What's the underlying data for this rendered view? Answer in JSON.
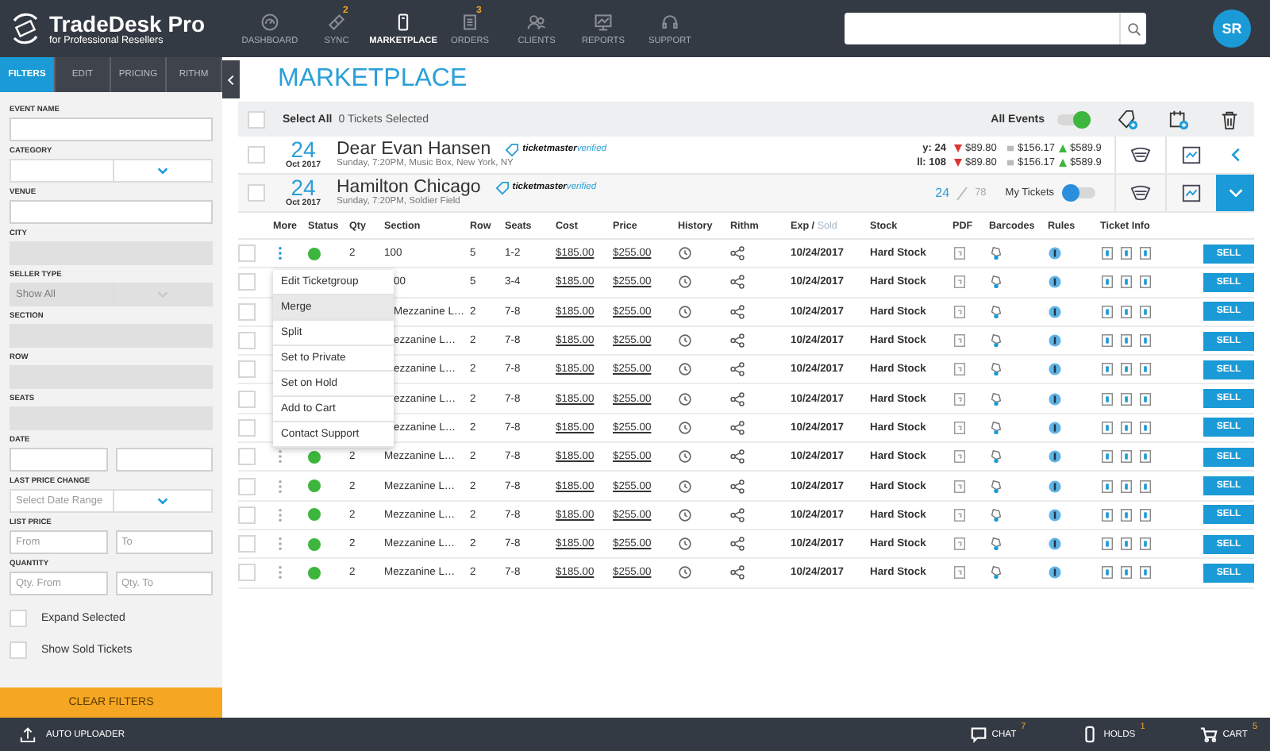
{
  "app": {
    "brand": "TradeDesk Pro",
    "tagline": "for Professional Resellers"
  },
  "nav": [
    {
      "label": "DASHBOARD",
      "kind": "gauge",
      "selected": false
    },
    {
      "label": "SYNC",
      "kind": "ticket",
      "badge": "2",
      "selected": false
    },
    {
      "label": "MARKETPLACE",
      "kind": "phone",
      "selected": true
    },
    {
      "label": "ORDERS",
      "kind": "orders",
      "badge": "3",
      "selected": false
    },
    {
      "label": "CLIENTS",
      "kind": "clients",
      "selected": false
    },
    {
      "label": "REPORTS",
      "kind": "reports",
      "selected": false
    },
    {
      "label": "SUPPORT",
      "kind": "support",
      "selected": false
    }
  ],
  "user": {
    "initials": "SR"
  },
  "sidebar": {
    "tabs": [
      {
        "label": "FILTERS",
        "selected": true
      },
      {
        "label": "EDIT",
        "selected": false
      },
      {
        "label": "PRICING",
        "selected": false
      },
      {
        "label": "RITHM",
        "selected": false
      }
    ],
    "fields": [
      {
        "label": "EVENT NAME",
        "kind": "text",
        "disabled": false
      },
      {
        "label": "CATEGORY",
        "kind": "select",
        "disabled": false
      },
      {
        "label": "VENUE",
        "kind": "text",
        "disabled": false
      },
      {
        "label": "CITY",
        "kind": "text",
        "disabled": true
      },
      {
        "label": "SELLER TYPE",
        "kind": "select",
        "disabled": true,
        "placeholder": "Show All"
      },
      {
        "label": "SECTION",
        "kind": "text",
        "disabled": true
      },
      {
        "label": "ROW",
        "kind": "text",
        "disabled": true
      },
      {
        "label": "SEATS",
        "kind": "text",
        "disabled": true
      },
      {
        "label": "DATE",
        "kind": "pair",
        "disabled": false
      },
      {
        "label": "LAST PRICE CHANGE",
        "kind": "select",
        "disabled": false,
        "placeholder": "Select Date Range"
      },
      {
        "label": "LIST PRICE",
        "kind": "pair",
        "disabled": false,
        "placeholders": [
          "From",
          "To"
        ]
      },
      {
        "label": "QUANTITY",
        "kind": "pair",
        "disabled": false,
        "placeholders": [
          "Qty. From",
          "Qty. To"
        ]
      }
    ],
    "checkboxes": [
      {
        "label": "Expand Selected",
        "checked": false
      },
      {
        "label": "Show Sold Tickets",
        "checked": false
      }
    ],
    "clear_button": "CLEAR FILTERS"
  },
  "page_title": "MARKETPLACE",
  "toolbar": {
    "select_all_checked": false,
    "select_all": "Select All",
    "selected_count": "0 Tickets Selected",
    "all_events_label": "All Events",
    "all_events_on": true
  },
  "events": [
    {
      "checked": false,
      "day": "24",
      "month": "Oct 2017",
      "name": "Dear Evan Hansen",
      "details": "Sunday, 7:20PM, Music Box, New York, NY",
      "verified_brand": "ticketmaster",
      "verified_word": "verified",
      "expanded": false,
      "stats": [
        {
          "label": "y: 24",
          "low": "$89.80",
          "avg": "$156.17",
          "high": "$589.9"
        },
        {
          "label": "ll: 108",
          "low": "$89.80",
          "avg": "$156.17",
          "high": "$589.9"
        }
      ]
    },
    {
      "checked": false,
      "day": "24",
      "month": "Oct 2017",
      "name": "Hamilton Chicago",
      "details": "Sunday, 7:20PM, Soldier Field",
      "verified_brand": "ticketmaster",
      "verified_word": "verified",
      "expanded": true,
      "my_count": "24",
      "total_count": "78",
      "my_tickets_label": "My Tickets",
      "my_tickets_on": false
    }
  ],
  "table": {
    "columns": [
      {
        "label": "More"
      },
      {
        "label": "Status"
      },
      {
        "label": "Qty"
      },
      {
        "label": "Section"
      },
      {
        "label": "Row"
      },
      {
        "label": "Seats"
      },
      {
        "label": "Cost"
      },
      {
        "label": "Price"
      },
      {
        "label": "History"
      },
      {
        "label": "Rithm"
      },
      {
        "label": "Exp /",
        "suffix": "Sold"
      },
      {
        "label": "Stock"
      },
      {
        "label": "PDF"
      },
      {
        "label": "Barcodes"
      },
      {
        "label": "Rules"
      },
      {
        "label": "Ticket Info"
      }
    ],
    "rows": [
      {
        "checked": false,
        "menu_open": true,
        "status_ok": true,
        "qty": "2",
        "section": "100",
        "row": "5",
        "seats": "1-2",
        "cost": "$185.00",
        "price": "$255.00",
        "exp": "10/24/2017",
        "stock": "Hard Stock",
        "action": "SELL"
      },
      {
        "checked": false,
        "section": "00",
        "row": "5",
        "seats": "3-4",
        "cost": "$185.00",
        "price": "$255.00",
        "exp": "10/24/2017",
        "stock": "Hard Stock",
        "action": "SELL"
      },
      {
        "checked": false,
        "section": "Mezzanine L…",
        "row": "2",
        "seats": "7-8",
        "cost": "$185.00",
        "price": "$255.00",
        "exp": "10/24/2017",
        "stock": "Hard Stock",
        "action": "SELL"
      },
      {
        "checked": false,
        "section": "ezzanine L…",
        "row": "2",
        "seats": "7-8",
        "cost": "$185.00",
        "price": "$255.00",
        "exp": "10/24/2017",
        "stock": "Hard Stock",
        "action": "SELL"
      },
      {
        "checked": false,
        "section": "ezzanine L…",
        "row": "2",
        "seats": "7-8",
        "cost": "$185.00",
        "price": "$255.00",
        "exp": "10/24/2017",
        "stock": "Hard Stock",
        "action": "SELL"
      },
      {
        "checked": false,
        "section": "ezzanine L…",
        "row": "2",
        "seats": "7-8",
        "cost": "$185.00",
        "price": "$255.00",
        "exp": "10/24/2017",
        "stock": "Hard Stock",
        "action": "SELL"
      },
      {
        "checked": false,
        "section": "ezzanine L…",
        "row": "2",
        "seats": "7-8",
        "cost": "$185.00",
        "price": "$255.00",
        "exp": "10/24/2017",
        "stock": "Hard Stock",
        "action": "SELL"
      },
      {
        "checked": false,
        "menu_open": false,
        "status_ok": true,
        "qty": "2",
        "section": "Mezzanine L…",
        "row": "2",
        "seats": "7-8",
        "cost": "$185.00",
        "price": "$255.00",
        "exp": "10/24/2017",
        "stock": "Hard Stock",
        "action": "SELL"
      },
      {
        "checked": false,
        "menu_open": false,
        "status_ok": true,
        "qty": "2",
        "section": "Mezzanine L…",
        "row": "2",
        "seats": "7-8",
        "cost": "$185.00",
        "price": "$255.00",
        "exp": "10/24/2017",
        "stock": "Hard Stock",
        "action": "SELL"
      },
      {
        "checked": false,
        "menu_open": false,
        "status_ok": true,
        "qty": "2",
        "section": "Mezzanine L…",
        "row": "2",
        "seats": "7-8",
        "cost": "$185.00",
        "price": "$255.00",
        "exp": "10/24/2017",
        "stock": "Hard Stock",
        "action": "SELL"
      },
      {
        "checked": false,
        "menu_open": false,
        "status_ok": true,
        "qty": "2",
        "section": "Mezzanine L…",
        "row": "2",
        "seats": "7-8",
        "cost": "$185.00",
        "price": "$255.00",
        "exp": "10/24/2017",
        "stock": "Hard Stock",
        "action": "SELL"
      },
      {
        "checked": false,
        "menu_open": false,
        "status_ok": true,
        "qty": "2",
        "section": "Mezzanine L…",
        "row": "2",
        "seats": "7-8",
        "cost": "$185.00",
        "price": "$255.00",
        "exp": "10/24/2017",
        "stock": "Hard Stock",
        "action": "SELL"
      }
    ]
  },
  "context_menu": {
    "items": [
      {
        "label": "Edit Ticketgroup",
        "selected": false
      },
      {
        "label": "Merge",
        "selected": true
      },
      {
        "label": "Split",
        "selected": false
      },
      {
        "label": "Set to Private",
        "selected": false
      },
      {
        "label": "Set on Hold",
        "selected": false
      },
      {
        "label": "Add to Cart",
        "selected": false
      },
      {
        "label": "Contact Support",
        "selected": false
      }
    ]
  },
  "status_bar": {
    "auto_uploader": "AUTO UPLOADER",
    "items": [
      {
        "label": "CHAT",
        "badge": "7",
        "kind": "chat"
      },
      {
        "label": "HOLDS",
        "badge": "1",
        "kind": "mobile"
      },
      {
        "label": "CART",
        "badge": "5",
        "kind": "cart"
      }
    ]
  }
}
